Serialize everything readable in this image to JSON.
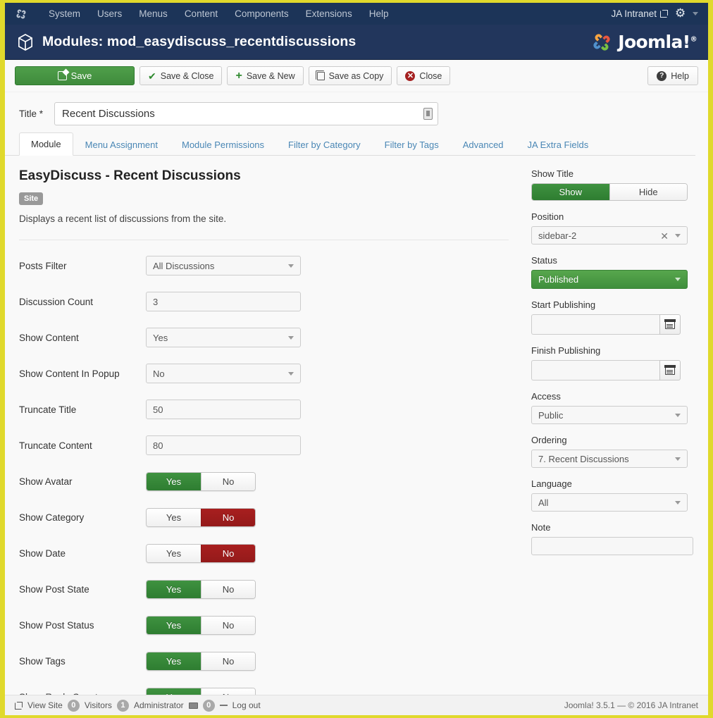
{
  "adminbar": {
    "logo_icon": "joomla-logo-icon",
    "menu": [
      "System",
      "Users",
      "Menus",
      "Content",
      "Components",
      "Extensions",
      "Help"
    ],
    "site_name": "JA Intranet",
    "site_link_icon": "external-link-icon",
    "gear_icon": "gear-icon",
    "caret_icon": "chevron-down-icon"
  },
  "page_header": {
    "icon": "cube-icon",
    "title": "Modules: mod_easydiscuss_recentdiscussions",
    "brand": "Joomla!",
    "brand_sup": "®"
  },
  "toolbar": {
    "save": "Save",
    "save_close": "Save & Close",
    "save_new": "Save & New",
    "save_copy": "Save as Copy",
    "close": "Close",
    "help": "Help"
  },
  "title_field": {
    "label": "Title",
    "required_mark": "*",
    "value": "Recent Discussions",
    "placeholder": ""
  },
  "tabs": [
    {
      "label": "Module",
      "active": true
    },
    {
      "label": "Menu Assignment",
      "active": false
    },
    {
      "label": "Module Permissions",
      "active": false
    },
    {
      "label": "Filter by Category",
      "active": false
    },
    {
      "label": "Filter by Tags",
      "active": false
    },
    {
      "label": "Advanced",
      "active": false
    },
    {
      "label": "JA Extra Fields",
      "active": false
    }
  ],
  "module": {
    "heading": "EasyDiscuss - Recent Discussions",
    "badge": "Site",
    "description": "Displays a recent list of discussions from the site."
  },
  "fields": [
    {
      "label": "Posts Filter",
      "type": "select",
      "value": "All Discussions"
    },
    {
      "label": "Discussion Count",
      "type": "input",
      "value": "3"
    },
    {
      "label": "Show Content",
      "type": "select",
      "value": "Yes"
    },
    {
      "label": "Show Content In Popup",
      "type": "select",
      "value": "No"
    },
    {
      "label": "Truncate Title",
      "type": "input",
      "value": "50"
    },
    {
      "label": "Truncate Content",
      "type": "input",
      "value": "80"
    },
    {
      "label": "Show Avatar",
      "type": "toggle",
      "yes": "Yes",
      "no": "No",
      "value": "Yes"
    },
    {
      "label": "Show Category",
      "type": "toggle",
      "yes": "Yes",
      "no": "No",
      "value": "No"
    },
    {
      "label": "Show Date",
      "type": "toggle",
      "yes": "Yes",
      "no": "No",
      "value": "No"
    },
    {
      "label": "Show Post State",
      "type": "toggle",
      "yes": "Yes",
      "no": "No",
      "value": "Yes"
    },
    {
      "label": "Show Post Status",
      "type": "toggle",
      "yes": "Yes",
      "no": "No",
      "value": "Yes"
    },
    {
      "label": "Show Tags",
      "type": "toggle",
      "yes": "Yes",
      "no": "No",
      "value": "Yes"
    },
    {
      "label": "Show Reply Count",
      "type": "toggle",
      "yes": "Yes",
      "no": "No",
      "value": "Yes"
    }
  ],
  "sidebar": {
    "show_title": {
      "label": "Show Title",
      "show": "Show",
      "hide": "Hide",
      "value": "Show"
    },
    "position": {
      "label": "Position",
      "value": "sidebar-2",
      "clear_icon": "clear-x-icon"
    },
    "status": {
      "label": "Status",
      "value": "Published"
    },
    "start_publishing": {
      "label": "Start Publishing",
      "value": "",
      "button_icon": "calendar-icon"
    },
    "finish_publishing": {
      "label": "Finish Publishing",
      "value": "",
      "button_icon": "calendar-icon"
    },
    "access": {
      "label": "Access",
      "value": "Public"
    },
    "ordering": {
      "label": "Ordering",
      "value": "7. Recent Discussions"
    },
    "language": {
      "label": "Language",
      "value": "All"
    },
    "note": {
      "label": "Note",
      "value": ""
    }
  },
  "footer": {
    "view_site": "View Site",
    "view_site_icon": "external-link-icon",
    "visitors_count": "0",
    "visitors_label": "Visitors",
    "admin_count": "1",
    "admin_label": "Administrator",
    "mail_icon": "mail-icon",
    "mail_count": "0",
    "logout": "Log out",
    "copyright": "Joomla! 3.5.1 — © 2016 JA Intranet"
  },
  "colors": {
    "adminbar_bg": "#1c3458",
    "header_bg": "#22365c",
    "page_frame": "#e0d92c",
    "green": "#3f8b3c",
    "red": "#a81f1f",
    "link_blue": "#4a87b5"
  }
}
